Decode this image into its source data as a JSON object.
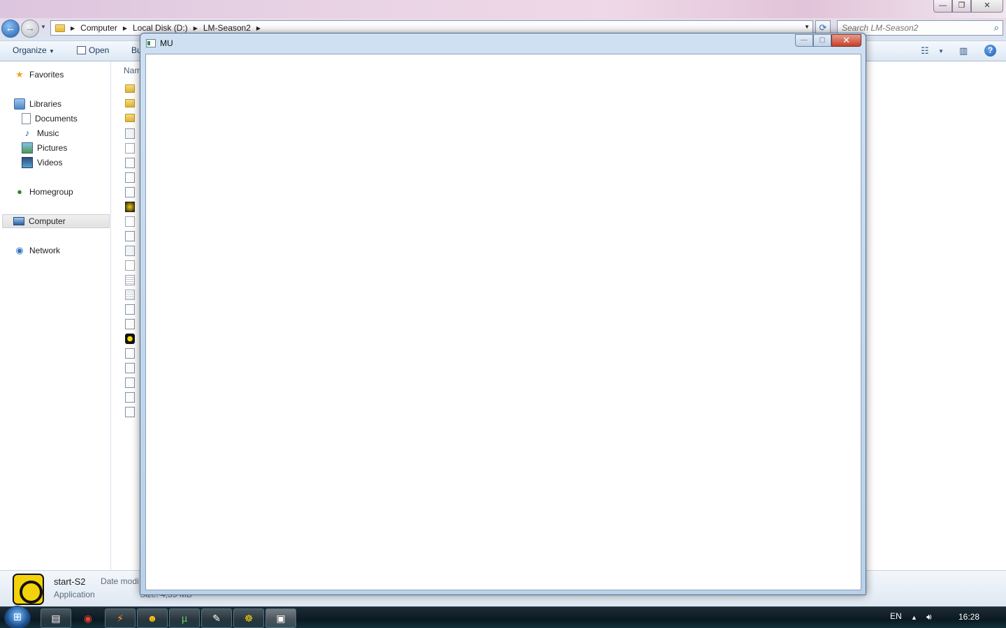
{
  "explorer": {
    "breadcrumbs": [
      "Computer",
      "Local Disk (D:)",
      "LM-Season2"
    ],
    "search_placeholder": "Search LM-Season2",
    "toolbar": {
      "organize": "Organize",
      "open": "Open",
      "burn": "Bu"
    },
    "nav": {
      "favorites": "Favorites",
      "libraries": "Libraries",
      "documents": "Documents",
      "music": "Music",
      "pictures": "Pictures",
      "videos": "Videos",
      "homegroup": "Homegroup",
      "computer": "Computer",
      "network": "Network"
    },
    "column_header": "Nam",
    "file_icons": [
      "folder",
      "folder",
      "folder",
      "gear",
      "blank",
      "dll",
      "dll",
      "dll",
      "game",
      "blank",
      "dll",
      "gear",
      "blank",
      "txt",
      "txt",
      "dll",
      "dll",
      "mu",
      "dll",
      "dll",
      "dll",
      "dll",
      "dll"
    ],
    "details": {
      "name": "start-S2",
      "type": "Application",
      "date_label": "Date modi",
      "size_label": "Size: 4,55 MB"
    }
  },
  "mu_window": {
    "title": "MU"
  },
  "taskbar": {
    "language": "EN",
    "time": "16:28",
    "buttons": [
      "explorer-icon",
      "chrome-icon",
      "winamp-icon",
      "smiley-icon",
      "utorrent-icon",
      "paint-icon",
      "mu-icon",
      "window-icon"
    ]
  },
  "colors": {
    "accent": "#1d5fb0",
    "mu_close": "#c6412a"
  }
}
